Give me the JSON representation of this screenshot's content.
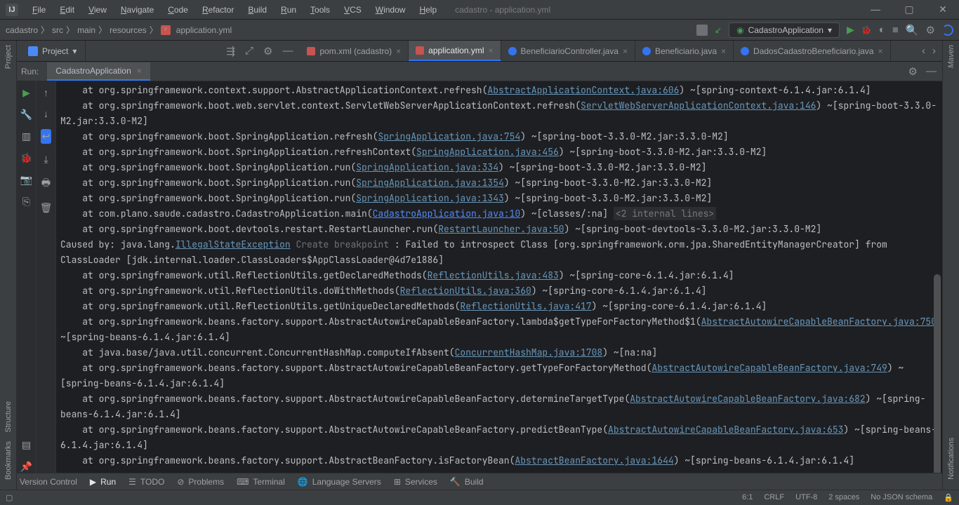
{
  "title": "cadastro - application.yml",
  "menu": [
    "File",
    "Edit",
    "View",
    "Navigate",
    "Code",
    "Refactor",
    "Build",
    "Run",
    "Tools",
    "VCS",
    "Window",
    "Help"
  ],
  "breadcrumb": [
    "cadastro",
    "src",
    "main",
    "resources",
    "application.yml"
  ],
  "runConfigLabel": "CadastroApplication",
  "projectLabel": "Project",
  "tabs": [
    {
      "label": "pom.xml (cadastro)",
      "type": "maven"
    },
    {
      "label": "application.yml",
      "type": "yml",
      "active": true
    },
    {
      "label": "BeneficiarioController.java",
      "type": "java"
    },
    {
      "label": "Beneficiario.java",
      "type": "java"
    },
    {
      "label": "DadosCadastroBeneficiario.java",
      "type": "java"
    }
  ],
  "leftStripe": {
    "top": "Project",
    "mid": "Structure",
    "bottom": "Bookmarks"
  },
  "rightStripe": {
    "top": "Maven",
    "bottom": "Notifications"
  },
  "run": {
    "label": "Run:",
    "tab": "CadastroApplication"
  },
  "console": {
    "lines": [
      {
        "pre": "    at org.springframework.context.support.AbstractApplicationContext.refresh(",
        "link": "AbstractApplicationContext.java:606",
        "post": ") ~[spring-context-6.1.4.jar:6.1.4]"
      },
      {
        "pre": "    at org.springframework.boot.web.servlet.context.ServletWebServerApplicationContext.refresh(",
        "link": "ServletWebServerApplicationContext.java:146",
        "post": ") ~[spring-boot-3.3.0-M2.jar:3.3.0-M2]",
        "wrap": true
      },
      {
        "pre": "    at org.springframework.boot.SpringApplication.refresh(",
        "link": "SpringApplication.java:754",
        "post": ") ~[spring-boot-3.3.0-M2.jar:3.3.0-M2]"
      },
      {
        "pre": "    at org.springframework.boot.SpringApplication.refreshContext(",
        "link": "SpringApplication.java:456",
        "post": ") ~[spring-boot-3.3.0-M2.jar:3.3.0-M2]"
      },
      {
        "pre": "    at org.springframework.boot.SpringApplication.run(",
        "link": "SpringApplication.java:334",
        "post": ") ~[spring-boot-3.3.0-M2.jar:3.3.0-M2]"
      },
      {
        "pre": "    at org.springframework.boot.SpringApplication.run(",
        "link": "SpringApplication.java:1354",
        "post": ") ~[spring-boot-3.3.0-M2.jar:3.3.0-M2]"
      },
      {
        "pre": "    at org.springframework.boot.SpringApplication.run(",
        "link": "SpringApplication.java:1343",
        "post": ") ~[spring-boot-3.3.0-M2.jar:3.3.0-M2]"
      },
      {
        "pre": "    at com.plano.saude.cadastro.CadastroApplication.main(",
        "link": "CadastroApplication.java:10",
        "linkColor": "blue",
        "post": ") ~[classes/:na] ",
        "hint": "<2 internal lines>",
        "expand": true
      },
      {
        "pre": "    at org.springframework.boot.devtools.restart.RestartLauncher.run(",
        "link": "RestartLauncher.java:50",
        "post": ") ~[spring-boot-devtools-3.3.0-M2.jar:3.3.0-M2]"
      },
      {
        "caused": true,
        "pre": "Caused by: java.lang.",
        "link": "IllegalStateException",
        "bp": "Create breakpoint",
        "post": " : Failed to introspect Class [org.springframework.orm.jpa.SharedEntityManagerCreator] from ClassLoader [jdk.internal.loader.ClassLoaders$AppClassLoader@4d7e1886]"
      },
      {
        "pre": "    at org.springframework.util.ReflectionUtils.getDeclaredMethods(",
        "link": "ReflectionUtils.java:483",
        "post": ") ~[spring-core-6.1.4.jar:6.1.4]"
      },
      {
        "pre": "    at org.springframework.util.ReflectionUtils.doWithMethods(",
        "link": "ReflectionUtils.java:360",
        "post": ") ~[spring-core-6.1.4.jar:6.1.4]"
      },
      {
        "pre": "    at org.springframework.util.ReflectionUtils.getUniqueDeclaredMethods(",
        "link": "ReflectionUtils.java:417",
        "post": ") ~[spring-core-6.1.4.jar:6.1.4]"
      },
      {
        "pre": "    at org.springframework.beans.factory.support.AbstractAutowireCapableBeanFactory.lambda$getTypeForFactoryMethod$1(",
        "link": "AbstractAutowireCapableBeanFactory.java:750",
        "post": ") ~[spring-beans-6.1.4.jar:6.1.4]",
        "wrap": true
      },
      {
        "pre": "    at java.base/java.util.concurrent.ConcurrentHashMap.computeIfAbsent(",
        "link": "ConcurrentHashMap.java:1708",
        "post": ") ~[na:na]"
      },
      {
        "pre": "    at org.springframework.beans.factory.support.AbstractAutowireCapableBeanFactory.getTypeForFactoryMethod(",
        "link": "AbstractAutowireCapableBeanFactory.java:749",
        "post": ") ~[spring-beans-6.1.4.jar:6.1.4]",
        "wrap": true
      },
      {
        "pre": "    at org.springframework.beans.factory.support.AbstractAutowireCapableBeanFactory.determineTargetType(",
        "link": "AbstractAutowireCapableBeanFactory.java:682",
        "post": ") ~[spring-beans-6.1.4.jar:6.1.4]",
        "wrap": true
      },
      {
        "pre": "    at org.springframework.beans.factory.support.AbstractAutowireCapableBeanFactory.predictBeanType(",
        "link": "AbstractAutowireCapableBeanFactory.java:653",
        "post": ") ~[spring-beans-6.1.4.jar:6.1.4]",
        "wrap": true
      },
      {
        "pre": "    at org.springframework.beans.factory.support.AbstractBeanFactory.isFactoryBean(",
        "link": "AbstractBeanFactory.java:1644",
        "post": ") ~[spring-beans-6.1.4.jar:6.1.4]"
      }
    ]
  },
  "bottomBar": {
    "items": [
      "Version Control",
      "Run",
      "TODO",
      "Problems",
      "Terminal",
      "Language Servers",
      "Services",
      "Build"
    ]
  },
  "status": {
    "pos": "6:1",
    "eol": "CRLF",
    "enc": "UTF-8",
    "indent": "2 spaces",
    "schema": "No JSON schema"
  }
}
